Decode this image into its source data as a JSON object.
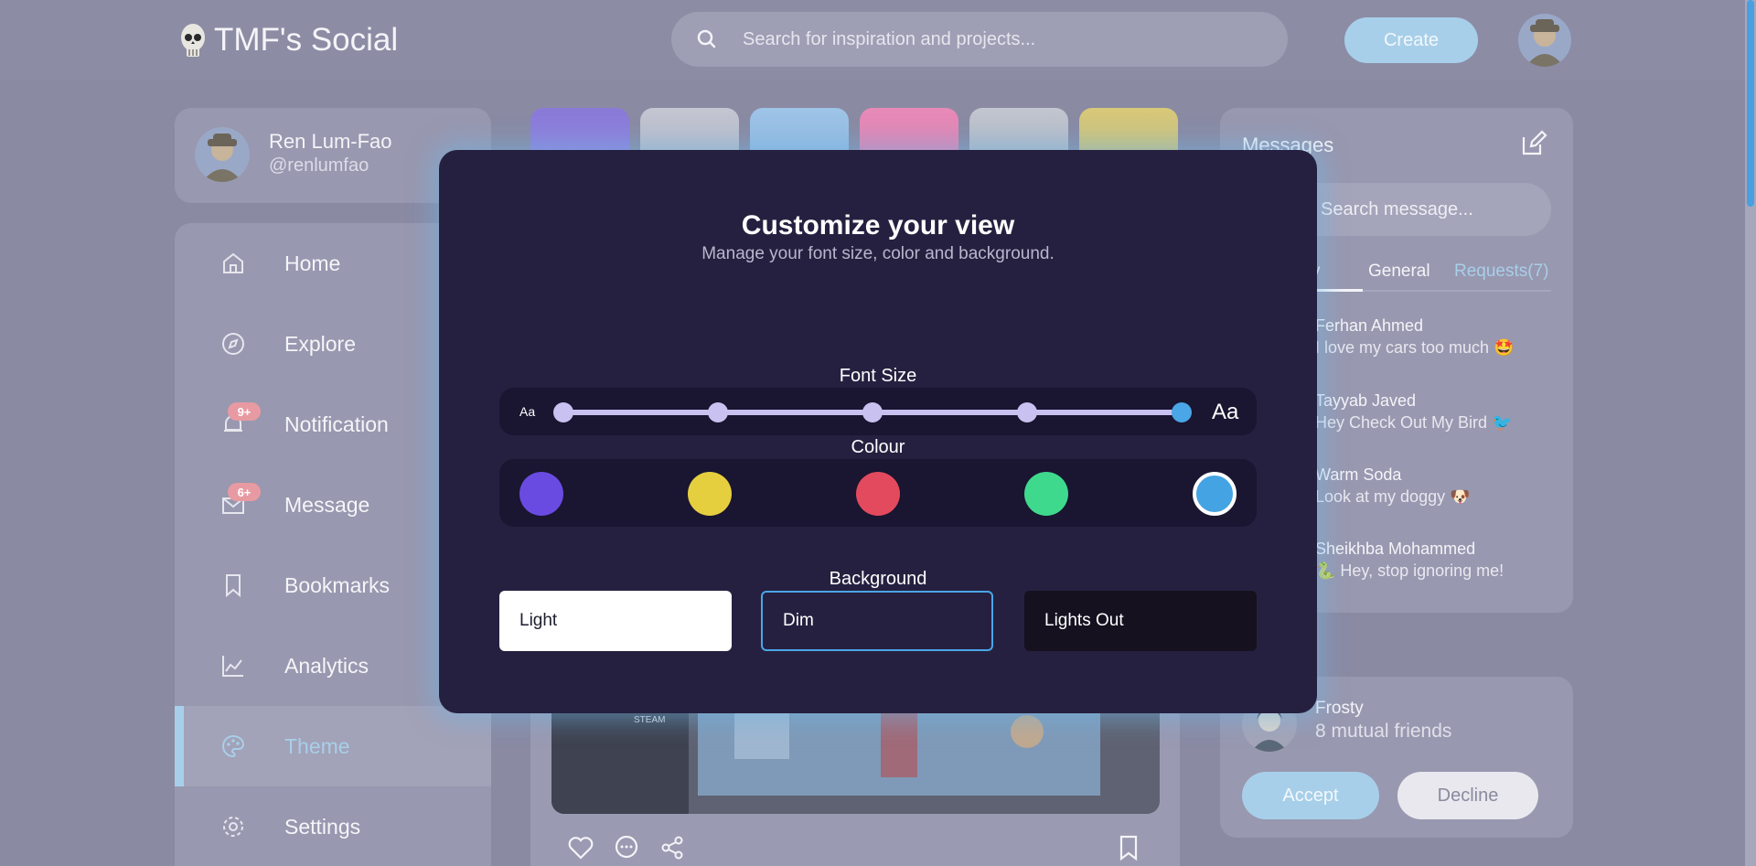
{
  "header": {
    "brand": "TMF's Social",
    "search_placeholder": "Search for inspiration and projects...",
    "create_label": "Create"
  },
  "profile": {
    "name": "Ren Lum-Fao",
    "handle": "@renlumfao"
  },
  "sidebar": {
    "items": [
      {
        "label": "Home",
        "icon": "home-icon"
      },
      {
        "label": "Explore",
        "icon": "compass-icon"
      },
      {
        "label": "Notification",
        "icon": "bell-icon",
        "badge": "9+"
      },
      {
        "label": "Message",
        "icon": "envelope-icon",
        "badge": "6+"
      },
      {
        "label": "Bookmarks",
        "icon": "bookmark-icon"
      },
      {
        "label": "Analytics",
        "icon": "chart-line-icon"
      },
      {
        "label": "Theme",
        "icon": "palette-icon",
        "active": true
      },
      {
        "label": "Settings",
        "icon": "gear-icon"
      }
    ]
  },
  "messages": {
    "title": "Messages",
    "search_placeholder": "Search message...",
    "tabs": [
      "y",
      "General",
      "Requests(7)"
    ],
    "items": [
      {
        "name": "Ferhan Ahmed",
        "text": "I love my cars too much 🤩"
      },
      {
        "name": "Tayyab Javed",
        "text": "Hey Check Out My Bird 🐦"
      },
      {
        "name": "Warm Soda",
        "text": "Look at my doggy 🐶"
      },
      {
        "name": "Sheikhba Mohammed",
        "text": "🐍 Hey, stop ignoring me!"
      }
    ]
  },
  "request": {
    "name": "Frosty",
    "mutual": "8 mutual friends",
    "accept_label": "Accept",
    "decline_label": "Decline"
  },
  "modal": {
    "title": "Customize your view",
    "subtitle": "Manage your font size, color and background.",
    "font_size_label": "Font Size",
    "font_small_label": "Aa",
    "font_large_label": "Aa",
    "font_size_steps": 5,
    "font_size_selected": 5,
    "colour_label": "Colour",
    "colours": [
      "#6a4be2",
      "#e6cf3f",
      "#e44a5d",
      "#3fd98e",
      "#44a3e2"
    ],
    "colour_selected": 4,
    "background_label": "Background",
    "background_options": [
      "Light",
      "Dim",
      "Lights Out"
    ],
    "background_selected": "Dim"
  },
  "feed": {
    "screen_label": "STEAM"
  },
  "colors": {
    "accent": "#a8cfe9",
    "modal_bg": "#262040",
    "primary_blue": "#4aa6e6"
  }
}
